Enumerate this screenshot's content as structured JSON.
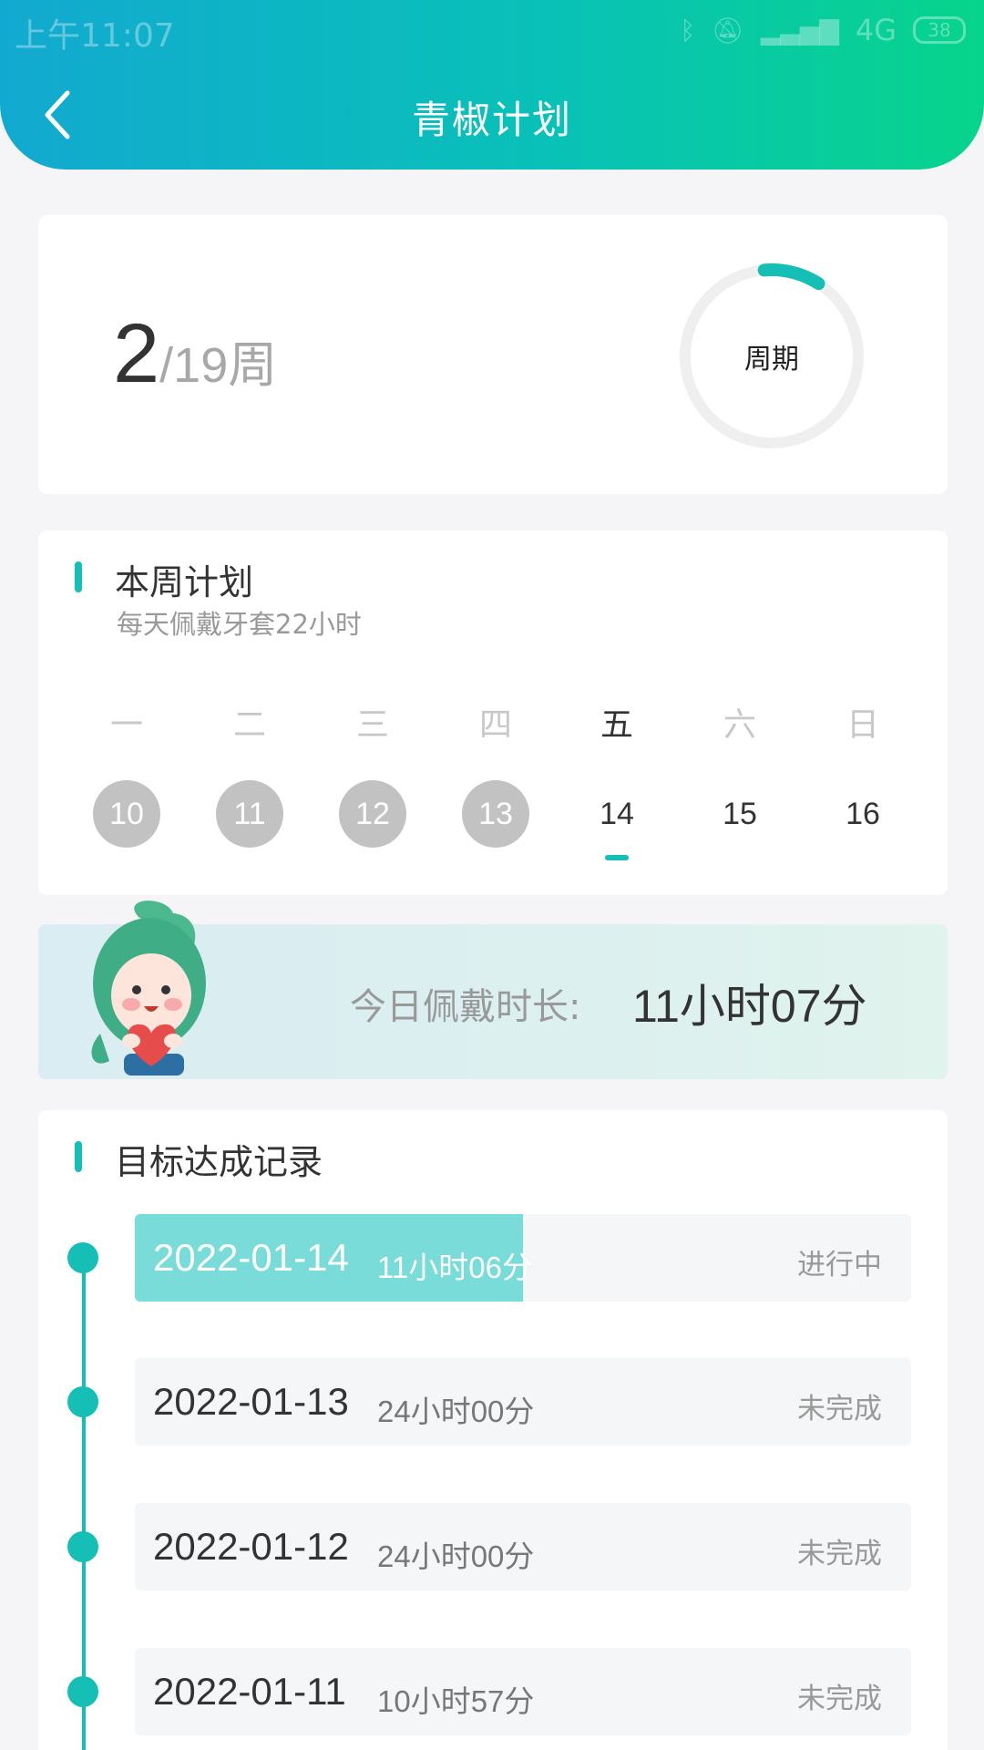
{
  "status_bar": {
    "time": "上午11:07",
    "network": "4G",
    "battery": "38"
  },
  "header": {
    "title": "青椒计划",
    "back_icon": "chevron-left-icon"
  },
  "cycle": {
    "current_week": "2",
    "total_weeks": "/19周",
    "ring_label": "周期",
    "progress_fraction": 0.105
  },
  "week_plan": {
    "title": "本周计划",
    "subtitle": "每天佩戴牙套22小时",
    "days": [
      {
        "name": "一",
        "num": "10",
        "state": "past"
      },
      {
        "name": "二",
        "num": "11",
        "state": "past"
      },
      {
        "name": "三",
        "num": "12",
        "state": "past"
      },
      {
        "name": "四",
        "num": "13",
        "state": "past"
      },
      {
        "name": "五",
        "num": "14",
        "state": "today"
      },
      {
        "name": "六",
        "num": "15",
        "state": "future"
      },
      {
        "name": "日",
        "num": "16",
        "state": "future"
      }
    ]
  },
  "today": {
    "label": "今日佩戴时长:",
    "value": "11小时07分"
  },
  "records": {
    "title": "目标达成记录",
    "items": [
      {
        "date": "2022-01-14",
        "duration": "11小时06分",
        "status": "进行中",
        "progress": 0.5
      },
      {
        "date": "2022-01-13",
        "duration": "24小时00分",
        "status": "未完成"
      },
      {
        "date": "2022-01-12",
        "duration": "24小时00分",
        "status": "未完成"
      },
      {
        "date": "2022-01-11",
        "duration": "10小时57分",
        "status": "未完成"
      }
    ]
  },
  "colors": {
    "accent": "#15bfb5",
    "header_start": "#12a9d0",
    "header_end": "#07d48c",
    "past_day": "#c2c2c2"
  }
}
